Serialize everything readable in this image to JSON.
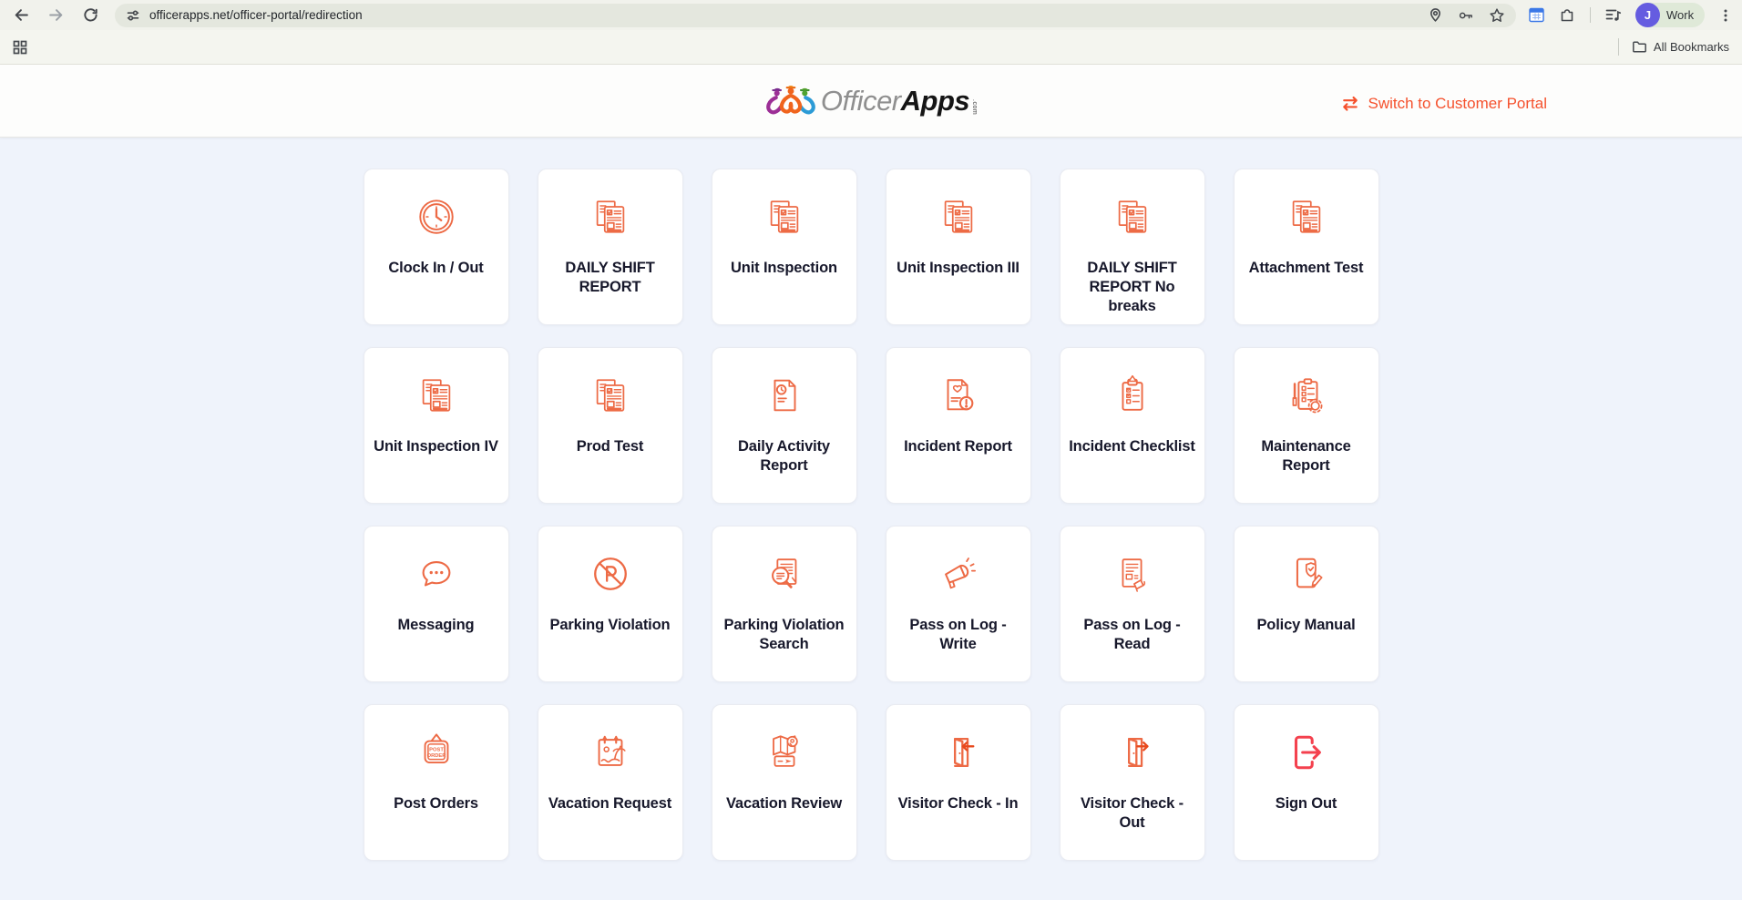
{
  "browser": {
    "url": "officerapps.net/officer-portal/redirection",
    "profile": {
      "initial": "J",
      "name": "Work"
    },
    "bookmarks_label": "All Bookmarks"
  },
  "header": {
    "logo_part1": "Officer",
    "logo_part2": "Apps",
    "logo_suffix": ".com",
    "switch_link_label": "Switch to Customer Portal"
  },
  "colors": {
    "accent": "#ED6A45",
    "signout": "#F4414E",
    "link": "#F5512D",
    "content_bg": "#EFF3FB"
  },
  "tiles": [
    {
      "label": "Clock In / Out",
      "icon": "clock"
    },
    {
      "label": "DAILY SHIFT REPORT",
      "icon": "report-stack"
    },
    {
      "label": "Unit Inspection",
      "icon": "report-stack"
    },
    {
      "label": "Unit Inspection III",
      "icon": "report-stack"
    },
    {
      "label": "DAILY SHIFT REPORT No breaks",
      "icon": "report-stack"
    },
    {
      "label": "Attachment Test",
      "icon": "report-stack"
    },
    {
      "label": "Unit Inspection IV",
      "icon": "report-stack"
    },
    {
      "label": "Prod Test",
      "icon": "report-stack"
    },
    {
      "label": "Daily Activity Report",
      "icon": "doc-clock"
    },
    {
      "label": "Incident Report",
      "icon": "doc-alert"
    },
    {
      "label": "Incident Checklist",
      "icon": "clipboard-warning"
    },
    {
      "label": "Maintenance Report",
      "icon": "clipboard-tools"
    },
    {
      "label": "Messaging",
      "icon": "chat-bubble"
    },
    {
      "label": "Parking Violation",
      "icon": "no-parking"
    },
    {
      "label": "Parking Violation Search",
      "icon": "doc-search"
    },
    {
      "label": "Pass on Log - Write",
      "icon": "megaphone"
    },
    {
      "label": "Pass on Log - Read",
      "icon": "news-megaphone"
    },
    {
      "label": "Policy Manual",
      "icon": "doc-shield"
    },
    {
      "label": "Post Orders",
      "icon": "post-order-sign",
      "icon_text": [
        "POST",
        "ORDER"
      ]
    },
    {
      "label": "Vacation Request",
      "icon": "calendar-beach"
    },
    {
      "label": "Vacation Review",
      "icon": "map-ticket"
    },
    {
      "label": "Visitor Check - In",
      "icon": "door-in"
    },
    {
      "label": "Visitor Check - Out",
      "icon": "door-out"
    },
    {
      "label": "Sign Out",
      "icon": "logout",
      "color": "#F4414E"
    }
  ]
}
